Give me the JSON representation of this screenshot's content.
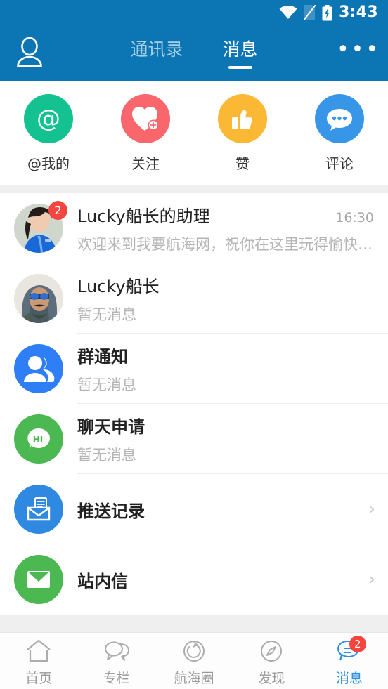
{
  "status_bar": {
    "time": "3:43",
    "icons": [
      "wifi-icon",
      "no-sim-icon",
      "battery-charging-icon"
    ]
  },
  "header": {
    "profile_icon": "person-icon",
    "more_icon": "more-horizontal-icon",
    "more_label": "•••",
    "tabs": [
      {
        "label": "通讯录",
        "active": false
      },
      {
        "label": "消息",
        "active": true
      }
    ],
    "background": "#0B76B3"
  },
  "quick_actions": [
    {
      "label": "@我的",
      "icon": "at-icon",
      "color": "#13C290"
    },
    {
      "label": "关注",
      "icon": "heart-plus-icon",
      "color": "#F9676C"
    },
    {
      "label": "赞",
      "icon": "thumbs-up-icon",
      "color": "#FBB834"
    },
    {
      "label": "评论",
      "icon": "comment-icon",
      "color": "#3796E8"
    }
  ],
  "messages": [
    {
      "title": "Lucky船长的助理",
      "subtitle": "欢迎来到我要航海网，祝你在这里玩得愉快！…",
      "time": "16:30",
      "badge": "2",
      "avatar": "photo-avatar-assistant",
      "type": "chat"
    },
    {
      "title": "Lucky船长",
      "subtitle": "暂无消息",
      "time": "",
      "badge": "",
      "avatar": "photo-avatar-captain",
      "type": "chat"
    },
    {
      "title": "群通知",
      "subtitle": "暂无消息",
      "time": "",
      "badge": "",
      "avatar": "group-icon",
      "avatar_color": "#2E7FF5",
      "type": "chat"
    },
    {
      "title": "聊天申请",
      "subtitle": "暂无消息",
      "time": "",
      "badge": "",
      "avatar": "hi-bubble-icon",
      "avatar_color": "#4CB851",
      "type": "chat"
    }
  ],
  "entries": [
    {
      "title": "推送记录",
      "avatar": "push-mail-icon",
      "avatar_color": "#3089E0",
      "chevron": "chevron-right-icon",
      "chevron_glyph": "›"
    },
    {
      "title": "站内信",
      "avatar": "inbox-mail-icon",
      "avatar_color": "#4CB851",
      "chevron": "chevron-right-icon",
      "chevron_glyph": "›"
    }
  ],
  "bottom_nav": [
    {
      "label": "首页",
      "icon": "home-icon",
      "active": false,
      "badge": ""
    },
    {
      "label": "专栏",
      "icon": "columns-icon",
      "active": false,
      "badge": ""
    },
    {
      "label": "航海圈",
      "icon": "circle-icon",
      "active": false,
      "badge": ""
    },
    {
      "label": "发现",
      "icon": "compass-icon",
      "active": false,
      "badge": ""
    },
    {
      "label": "消息",
      "icon": "message-icon",
      "active": true,
      "badge": "2"
    }
  ],
  "colors": {
    "header_blue": "#0B76B3",
    "accent_blue": "#2E8FE0",
    "badge_red": "#F5453F",
    "band_gray": "#EFEFEF"
  }
}
